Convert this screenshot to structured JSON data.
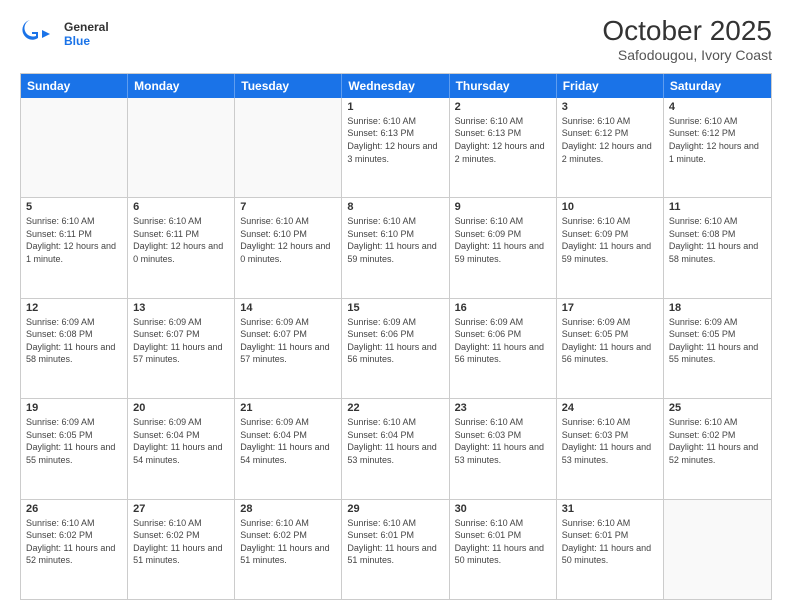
{
  "logo": {
    "line1": "General",
    "line2": "Blue"
  },
  "header": {
    "title": "October 2025",
    "subtitle": "Safodougou, Ivory Coast"
  },
  "weekdays": [
    "Sunday",
    "Monday",
    "Tuesday",
    "Wednesday",
    "Thursday",
    "Friday",
    "Saturday"
  ],
  "rows": [
    [
      {
        "empty": true
      },
      {
        "empty": true
      },
      {
        "empty": true
      },
      {
        "day": 1,
        "sunrise": "6:10 AM",
        "sunset": "6:13 PM",
        "daylight": "12 hours and 3 minutes."
      },
      {
        "day": 2,
        "sunrise": "6:10 AM",
        "sunset": "6:13 PM",
        "daylight": "12 hours and 2 minutes."
      },
      {
        "day": 3,
        "sunrise": "6:10 AM",
        "sunset": "6:12 PM",
        "daylight": "12 hours and 2 minutes."
      },
      {
        "day": 4,
        "sunrise": "6:10 AM",
        "sunset": "6:12 PM",
        "daylight": "12 hours and 1 minute."
      }
    ],
    [
      {
        "day": 5,
        "sunrise": "6:10 AM",
        "sunset": "6:11 PM",
        "daylight": "12 hours and 1 minute."
      },
      {
        "day": 6,
        "sunrise": "6:10 AM",
        "sunset": "6:11 PM",
        "daylight": "12 hours and 0 minutes."
      },
      {
        "day": 7,
        "sunrise": "6:10 AM",
        "sunset": "6:10 PM",
        "daylight": "12 hours and 0 minutes."
      },
      {
        "day": 8,
        "sunrise": "6:10 AM",
        "sunset": "6:10 PM",
        "daylight": "11 hours and 59 minutes."
      },
      {
        "day": 9,
        "sunrise": "6:10 AM",
        "sunset": "6:09 PM",
        "daylight": "11 hours and 59 minutes."
      },
      {
        "day": 10,
        "sunrise": "6:10 AM",
        "sunset": "6:09 PM",
        "daylight": "11 hours and 59 minutes."
      },
      {
        "day": 11,
        "sunrise": "6:10 AM",
        "sunset": "6:08 PM",
        "daylight": "11 hours and 58 minutes."
      }
    ],
    [
      {
        "day": 12,
        "sunrise": "6:09 AM",
        "sunset": "6:08 PM",
        "daylight": "11 hours and 58 minutes."
      },
      {
        "day": 13,
        "sunrise": "6:09 AM",
        "sunset": "6:07 PM",
        "daylight": "11 hours and 57 minutes."
      },
      {
        "day": 14,
        "sunrise": "6:09 AM",
        "sunset": "6:07 PM",
        "daylight": "11 hours and 57 minutes."
      },
      {
        "day": 15,
        "sunrise": "6:09 AM",
        "sunset": "6:06 PM",
        "daylight": "11 hours and 56 minutes."
      },
      {
        "day": 16,
        "sunrise": "6:09 AM",
        "sunset": "6:06 PM",
        "daylight": "11 hours and 56 minutes."
      },
      {
        "day": 17,
        "sunrise": "6:09 AM",
        "sunset": "6:05 PM",
        "daylight": "11 hours and 56 minutes."
      },
      {
        "day": 18,
        "sunrise": "6:09 AM",
        "sunset": "6:05 PM",
        "daylight": "11 hours and 55 minutes."
      }
    ],
    [
      {
        "day": 19,
        "sunrise": "6:09 AM",
        "sunset": "6:05 PM",
        "daylight": "11 hours and 55 minutes."
      },
      {
        "day": 20,
        "sunrise": "6:09 AM",
        "sunset": "6:04 PM",
        "daylight": "11 hours and 54 minutes."
      },
      {
        "day": 21,
        "sunrise": "6:09 AM",
        "sunset": "6:04 PM",
        "daylight": "11 hours and 54 minutes."
      },
      {
        "day": 22,
        "sunrise": "6:10 AM",
        "sunset": "6:04 PM",
        "daylight": "11 hours and 53 minutes."
      },
      {
        "day": 23,
        "sunrise": "6:10 AM",
        "sunset": "6:03 PM",
        "daylight": "11 hours and 53 minutes."
      },
      {
        "day": 24,
        "sunrise": "6:10 AM",
        "sunset": "6:03 PM",
        "daylight": "11 hours and 53 minutes."
      },
      {
        "day": 25,
        "sunrise": "6:10 AM",
        "sunset": "6:02 PM",
        "daylight": "11 hours and 52 minutes."
      }
    ],
    [
      {
        "day": 26,
        "sunrise": "6:10 AM",
        "sunset": "6:02 PM",
        "daylight": "11 hours and 52 minutes."
      },
      {
        "day": 27,
        "sunrise": "6:10 AM",
        "sunset": "6:02 PM",
        "daylight": "11 hours and 51 minutes."
      },
      {
        "day": 28,
        "sunrise": "6:10 AM",
        "sunset": "6:02 PM",
        "daylight": "11 hours and 51 minutes."
      },
      {
        "day": 29,
        "sunrise": "6:10 AM",
        "sunset": "6:01 PM",
        "daylight": "11 hours and 51 minutes."
      },
      {
        "day": 30,
        "sunrise": "6:10 AM",
        "sunset": "6:01 PM",
        "daylight": "11 hours and 50 minutes."
      },
      {
        "day": 31,
        "sunrise": "6:10 AM",
        "sunset": "6:01 PM",
        "daylight": "11 hours and 50 minutes."
      },
      {
        "empty": true
      }
    ]
  ]
}
